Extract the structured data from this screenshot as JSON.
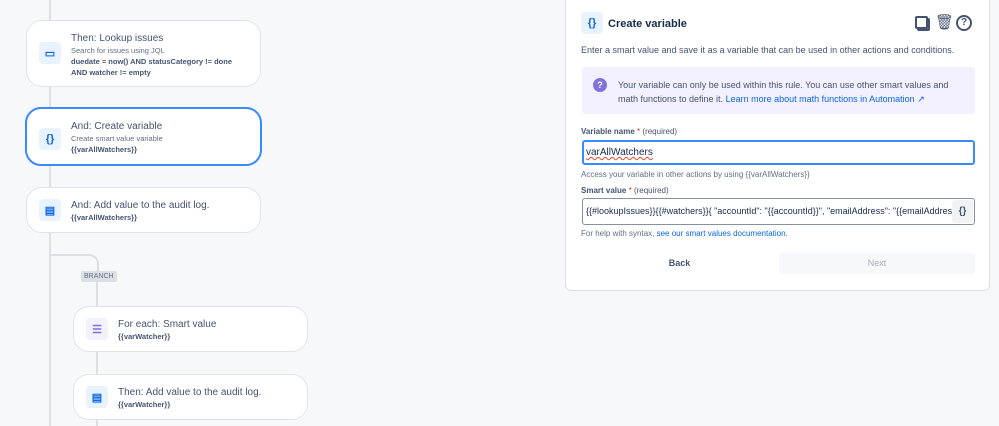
{
  "flow": {
    "cards": [
      {
        "title": "Then: Lookup issues",
        "subtitle": "Search for issues using JQL",
        "detail_1": "duedate = now() AND statusCategory != done",
        "detail_2": "AND watcher != empty"
      },
      {
        "title": "And: Create variable",
        "subtitle": "Create smart value variable",
        "detail_1": "{{varAllWatchers}}"
      },
      {
        "title": "And: Add value to the audit log.",
        "detail_1": "{{varAllWatchers}}"
      },
      {
        "title": "For each: Smart value",
        "detail_1": "{{varWatcher}}"
      },
      {
        "title": "Then: Add value to the audit log.",
        "detail_1": "{{varWatcher}}"
      }
    ],
    "branch_label": "BRANCH"
  },
  "panel": {
    "title": "Create variable",
    "description": "Enter a smart value and save it as a variable that can be used in other actions and conditions.",
    "info_text": "Your variable can only be used within this rule. You can use other smart values and math functions to define it.",
    "info_link": "Learn more about math functions in Automation ↗",
    "var_name_label": "Variable name",
    "required_mark": "*",
    "required_text": "(required)",
    "var_name_value": "varAllWatchers",
    "var_name_help": "Access your variable in other actions by using {{varAllWatchers}}",
    "smart_value_label": "Smart value",
    "smart_value": "{{#lookupIssues}}{{#watchers}}{ \"accountId\": \"{{accountId}}\", \"emailAddress\": \"{{emailAddress}}\"",
    "syntax_help": "For help with syntax,",
    "syntax_link": "see our smart values documentation.",
    "back_label": "Back",
    "next_label": "Next"
  },
  "colors": {
    "accent": "#0c66e4",
    "selected_border": "#388bff",
    "info_bg": "#f3f0ff",
    "info_icon": "#8270db"
  }
}
